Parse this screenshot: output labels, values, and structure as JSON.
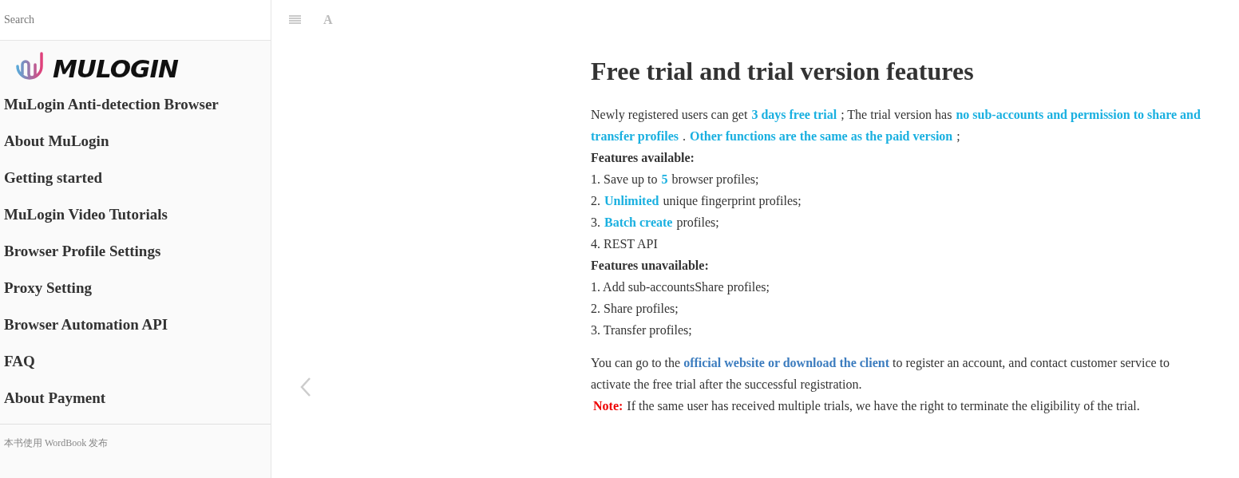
{
  "sidebar": {
    "search": {
      "placeholder": "Search"
    },
    "logo": {
      "text": "MULOGIN"
    },
    "items": [
      {
        "label": "MuLogin Anti-detection Browser"
      },
      {
        "label": "About MuLogin"
      },
      {
        "label": "Getting started"
      },
      {
        "label": "MuLogin Video Tutorials"
      },
      {
        "label": "Browser Profile Settings"
      },
      {
        "label": "Proxy Setting"
      },
      {
        "label": "Browser Automation API"
      },
      {
        "label": "FAQ"
      },
      {
        "label": "About Payment"
      }
    ],
    "footer": "本书使用 WordBook 发布"
  },
  "toolbar": {
    "font_button": "A"
  },
  "article": {
    "title": "Free trial and trial version features",
    "blocks": [
      {
        "kind": "text",
        "segments": [
          {
            "kind": "plain",
            "text": "Newly registered users can get"
          },
          {
            "kind": "highlight",
            "text": "3 days free trial"
          },
          {
            "kind": "plain",
            "text": "; The trial version has"
          },
          {
            "kind": "highlight",
            "text": "no sub-accounts and permission to share and transfer profiles"
          },
          {
            "kind": "plain",
            "text": "."
          },
          {
            "kind": "highlight",
            "text": "Other functions are the same as the paid version"
          },
          {
            "kind": "plain",
            "text": ";"
          }
        ]
      },
      {
        "kind": "heading",
        "segments": [
          {
            "kind": "plain",
            "text": "Features available:"
          }
        ]
      },
      {
        "kind": "text",
        "segments": [
          {
            "kind": "plain",
            "text": "1. Save up to"
          },
          {
            "kind": "highlight",
            "text": "5"
          },
          {
            "kind": "plain",
            "text": "browser profiles;"
          }
        ]
      },
      {
        "kind": "text",
        "segments": [
          {
            "kind": "plain",
            "text": "2."
          },
          {
            "kind": "highlight",
            "text": "Unlimited"
          },
          {
            "kind": "plain",
            "text": "unique fingerprint profiles;"
          }
        ]
      },
      {
        "kind": "text",
        "segments": [
          {
            "kind": "plain",
            "text": "3."
          },
          {
            "kind": "highlight",
            "text": "Batch create"
          },
          {
            "kind": "plain",
            "text": "profiles;"
          }
        ]
      },
      {
        "kind": "text",
        "segments": [
          {
            "kind": "plain",
            "text": "4. REST API"
          }
        ]
      },
      {
        "kind": "heading",
        "segments": [
          {
            "kind": "plain",
            "text": "Features unavailable:"
          }
        ]
      },
      {
        "kind": "text",
        "segments": [
          {
            "kind": "plain",
            "text": "1. Add sub-accountsShare profiles;"
          }
        ]
      },
      {
        "kind": "text",
        "segments": [
          {
            "kind": "plain",
            "text": "2. Share profiles;"
          }
        ]
      },
      {
        "kind": "text",
        "segments": [
          {
            "kind": "plain",
            "text": "3. Transfer profiles;"
          }
        ]
      },
      {
        "kind": "gap-text",
        "segments": [
          {
            "kind": "plain",
            "text": "You can go to the"
          },
          {
            "kind": "link",
            "text": "official website or download the client"
          },
          {
            "kind": "plain",
            "text": "to register an account, and contact customer service to activate the free trial after the successful registration."
          }
        ]
      },
      {
        "kind": "text",
        "segments": [
          {
            "kind": "note",
            "text": "Note:"
          },
          {
            "kind": "plain",
            "text": "If the same user has received multiple trials, we have the right to terminate the eligibility of the trial."
          }
        ]
      }
    ]
  }
}
